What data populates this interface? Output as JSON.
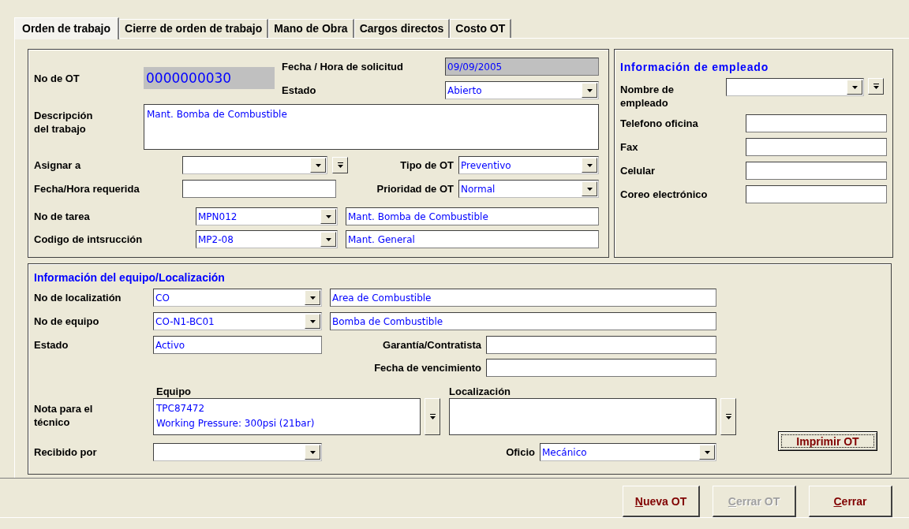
{
  "tabs": [
    {
      "label": "Orden de trabajo",
      "selected": true
    },
    {
      "label": "Cierre de orden de trabajo",
      "selected": false
    },
    {
      "label": "Mano de Obra",
      "selected": false
    },
    {
      "label": "Cargos directos",
      "selected": false
    },
    {
      "label": "Costo OT",
      "selected": false
    }
  ],
  "work_order": {
    "ot_number": {
      "label": "No de OT",
      "value": "0000000030"
    },
    "request_date": {
      "label": "Fecha / Hora de solicitud",
      "value": "09/09/2005",
      "kind": "readonly"
    },
    "status": {
      "label": "Estado",
      "value": "Abierto",
      "kind": "combo"
    },
    "description": {
      "label": "Descripción del trabajo",
      "value": "Mant. Bomba de Combustible"
    },
    "assign_to": {
      "label": "Asignar a",
      "kind": "combo",
      "picker": true
    },
    "ot_type": {
      "label": "Tipo de OT",
      "value": "Preventivo",
      "kind": "combo"
    },
    "required_date": {
      "label": "Fecha/Hora requerida",
      "kind": "text"
    },
    "priority": {
      "label": "Prioridad de OT",
      "value": "Normal",
      "kind": "combo"
    },
    "task": {
      "label": "No de tarea",
      "code": "MPN012",
      "description": "Mant. Bomba de Combustible"
    },
    "instruction": {
      "label": "Codigo de intsrucción",
      "code": "MP2-08",
      "description": "Mant. General"
    }
  },
  "employee": {
    "title": "Información de empleado",
    "name": {
      "label": "Nombre de empleado",
      "kind": "combo",
      "picker": true
    },
    "fields": [
      {
        "label": "Telefono oficina"
      },
      {
        "label": "Fax"
      },
      {
        "label": "Celular"
      },
      {
        "label": "Coreo electrónico"
      }
    ]
  },
  "equipment": {
    "title": "Información del equipo/Localización",
    "location": {
      "label": "No de localizatión",
      "code": "CO",
      "description": "Area de Combustible"
    },
    "equipment_no": {
      "label": "No de equipo",
      "code": "CO-N1-BC01",
      "description": "Bomba de Combustible"
    },
    "status": {
      "label": "Estado",
      "value": "Activo",
      "kind": "text"
    },
    "warranty": {
      "label": "Garantía/Contratista",
      "kind": "text"
    },
    "expiry": {
      "label": "Fecha  de vencimiento",
      "kind": "text"
    },
    "notes": {
      "label": "Nota para el técnico",
      "equipment_label": "Equipo",
      "equipment_lines": [
        "TPC87472",
        "Working Pressure: 300psi (21bar)"
      ],
      "location_label": "Localización"
    },
    "received_by": {
      "label": "Recibido por",
      "kind": "combo"
    },
    "trade": {
      "label": "Oficio",
      "value": "Mecánico",
      "kind": "combo"
    },
    "print_button": "Imprimir OT"
  },
  "buttons": [
    {
      "label": "Nueva OT",
      "disabled": false
    },
    {
      "label": "Cerrar OT",
      "disabled": true
    },
    {
      "label": "Cerrar",
      "disabled": false
    }
  ]
}
